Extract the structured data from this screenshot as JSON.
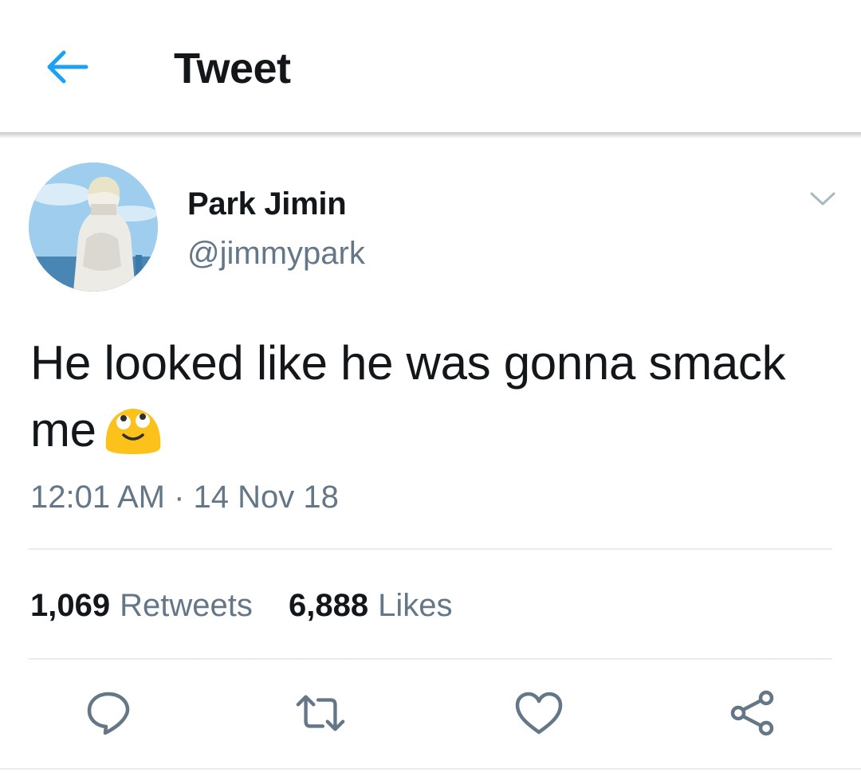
{
  "header": {
    "title": "Tweet",
    "back_icon": "arrow-left-icon",
    "accent_color": "#1da1f2"
  },
  "author": {
    "display_name": "Park Jimin",
    "handle": "@jimmypark",
    "avatar": "profile-photo",
    "menu_icon": "chevron-down-icon"
  },
  "tweet": {
    "text": "He looked like he was gonna smack me",
    "emoji": "relieved-face-emoji",
    "timestamp": "12:01 AM · 14 Nov 18"
  },
  "stats": {
    "retweets_count": "1,069",
    "retweets_label": "Retweets",
    "likes_count": "6,888",
    "likes_label": "Likes"
  },
  "actions": [
    {
      "icon": "reply-icon"
    },
    {
      "icon": "retweet-icon"
    },
    {
      "icon": "heart-icon"
    },
    {
      "icon": "share-icon"
    }
  ],
  "colors": {
    "text_primary": "#14171a",
    "text_secondary": "#657786",
    "divider": "#e6ecf0",
    "icon": "#657786"
  }
}
